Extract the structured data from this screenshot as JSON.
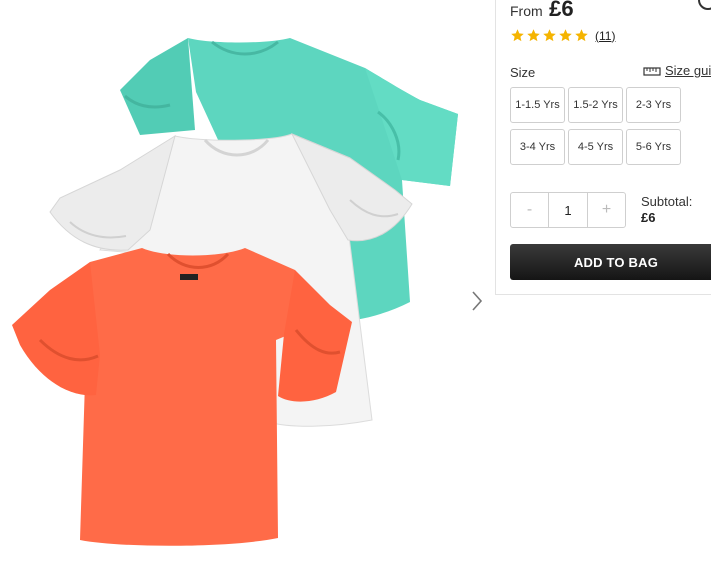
{
  "product": {
    "price_prefix": "From",
    "price": "£6",
    "rating": 5,
    "review_count": "(11)",
    "image_icon": "tshirt-pack-image",
    "colors": {
      "teal": "#5cd6be",
      "white": "#f3f3f3",
      "coral": "#ff6a47",
      "star": "#f5b400"
    }
  },
  "size": {
    "label": "Size",
    "guide_label": "Size guide",
    "options": [
      "1-1.5 Yrs",
      "1.5-2 Yrs",
      "2-3 Yrs",
      "3-4 Yrs",
      "4-5 Yrs",
      "5-6 Yrs"
    ]
  },
  "quantity": {
    "minus": "-",
    "value": "1",
    "plus": "+"
  },
  "subtotal": {
    "label": "Subtotal:",
    "value": "£6"
  },
  "add_to_bag": "ADD TO BAG"
}
